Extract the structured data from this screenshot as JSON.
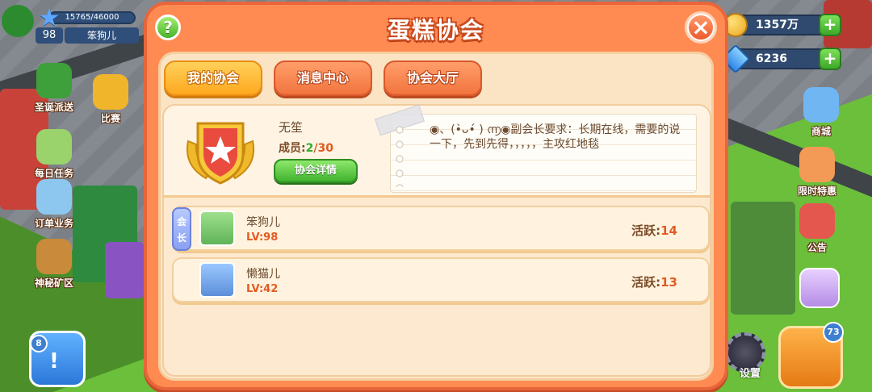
{
  "hud": {
    "exp_text": "15765/46000",
    "level": "98",
    "player_name": "笨狗儿",
    "coins": "1357万",
    "gems": "6236"
  },
  "side_left": [
    {
      "label": "圣诞派送",
      "icon": "christmas-tree-icon",
      "color": "#3da03a"
    },
    {
      "label": "比赛",
      "icon": "trophy-icon",
      "color": "#f0b52b"
    },
    {
      "label": "每日任务",
      "icon": "calendar-icon",
      "color": "#9ad36b"
    },
    {
      "label": "订单业务",
      "icon": "clipboard-icon",
      "color": "#8dc7ef"
    },
    {
      "label": "神秘矿区",
      "icon": "mine-cart-icon",
      "color": "#c98a3c"
    }
  ],
  "side_right": [
    {
      "label": "商城",
      "icon": "shopping-cart-icon",
      "color": "#6fb6f2"
    },
    {
      "label": "限时特惠",
      "icon": "gift-box-icon",
      "color": "#f49a57"
    },
    {
      "label": "公告",
      "icon": "notice-board-icon",
      "color": "#e4574f"
    }
  ],
  "bottom": {
    "calendar_badge": "8",
    "settings_label": "设置",
    "shop_badge": "73"
  },
  "dialog": {
    "title": "蛋糕协会",
    "tabs": [
      "我的协会",
      "消息中心",
      "协会大厅"
    ],
    "active_tab": 0,
    "guild": {
      "name": "无笙",
      "members_label": "成员:",
      "members_current": "2",
      "members_max": "/30",
      "detail_button": "协会详情",
      "notice": "◉、(•̀ᴗ•́ ) ൬◉副会长要求：长期在线，需要的说一下，先到先得，，，，，主攻红地毯"
    },
    "members": [
      {
        "role": "会长",
        "name": "笨狗儿",
        "level": "LV:98",
        "activity_label": "活跃:",
        "activity": "14"
      },
      {
        "role": "",
        "name": "懒猫儿",
        "level": "LV:42",
        "activity_label": "活跃:",
        "activity": "13"
      }
    ]
  },
  "colors": {
    "dialog_orange": "#ff8a52",
    "tab_active": "#ffb02a",
    "button_green": "#3fb22e",
    "highlight_orange": "#e25b23"
  }
}
